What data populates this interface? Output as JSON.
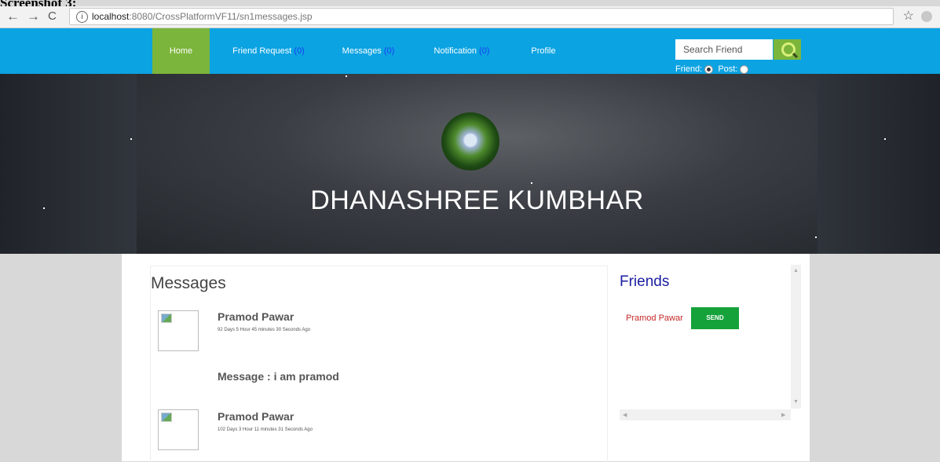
{
  "caption": "Screenshot 3:",
  "browser": {
    "back": "←",
    "forward": "→",
    "reload": "C",
    "url_host": "localhost",
    "url_path": ":8080/CrossPlatformVF11/sn1messages.jsp",
    "bookmark": "☆"
  },
  "nav": {
    "home": "Home",
    "friend_request": "Friend Request",
    "friend_request_count": "(0)",
    "messages": "Messages",
    "messages_count": "(0)",
    "notification": "Notification",
    "notification_count": "(0)",
    "profile": "Profile"
  },
  "search": {
    "value": "Search Friend",
    "filter_friend": "Friend:",
    "filter_post": "Post:"
  },
  "profile": {
    "name": "DHANASHREE KUMBHAR"
  },
  "messages": {
    "title": "Messages",
    "items": [
      {
        "sender": "Pramod Pawar",
        "time": "92 Days 5 Hour 45 minutes 30 Seconds Ago",
        "text": "Message : i am pramod"
      },
      {
        "sender": "Pramod Pawar",
        "time": "102 Days 3 Hour 11 minutes 31 Seconds Ago"
      }
    ]
  },
  "friends": {
    "title": "Friends",
    "items": [
      {
        "name": "Pramod Pawar",
        "action": "SEND"
      }
    ]
  },
  "colors": {
    "navbar": "#0ba3e2",
    "accent_green": "#7cb53b",
    "send_green": "#16a23a",
    "friend_name": "#c62828",
    "friends_title": "#1b1da0"
  }
}
